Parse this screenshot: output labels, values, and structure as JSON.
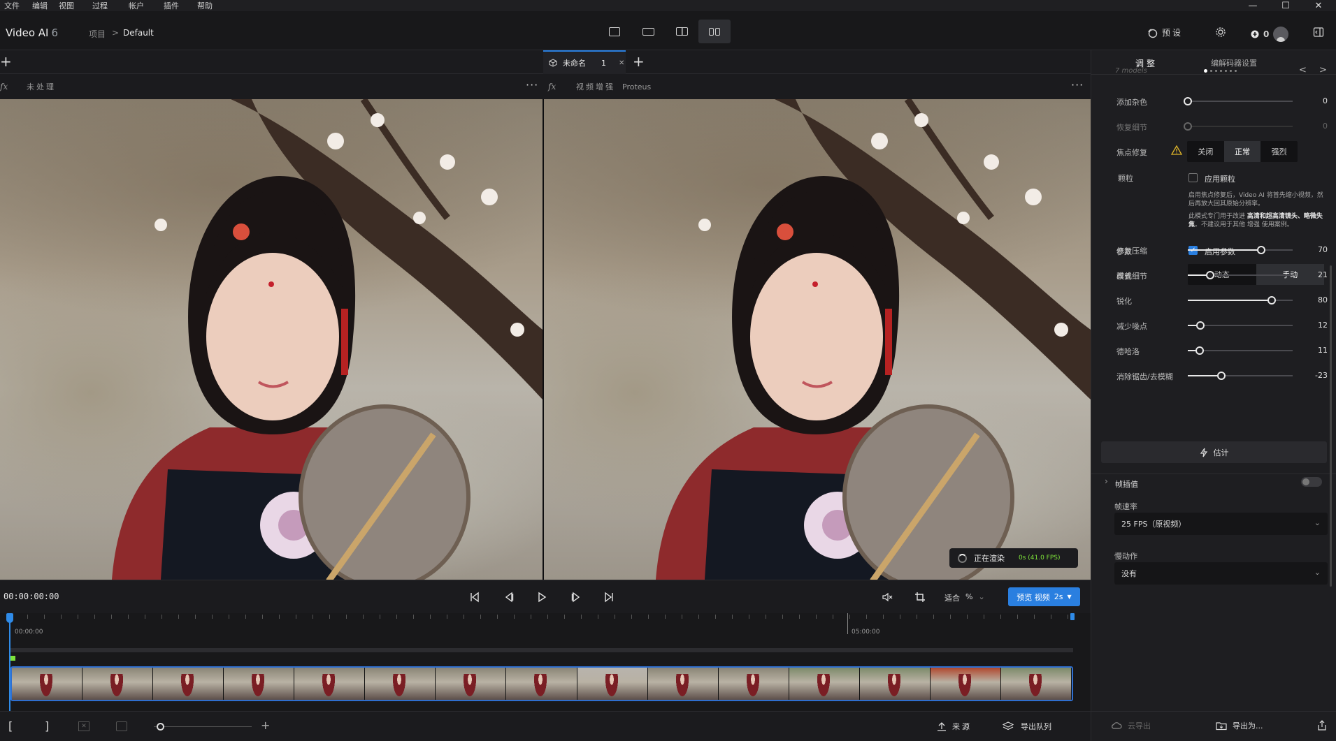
{
  "menubar": {
    "items": [
      "文件",
      "编辑",
      "视图",
      "过程",
      "帐户",
      "插件",
      "帮助"
    ]
  },
  "window_controls": {
    "minimize": "—",
    "maximize": "☐",
    "close": "✕"
  },
  "header": {
    "app_name": "Video AI",
    "app_version": "6",
    "breadcrumb_project": "项目",
    "breadcrumb_sep": ">",
    "breadcrumb_current": "Default",
    "presets_label": "预设",
    "credits": "0"
  },
  "left_pane": {
    "add_tab": "+",
    "fx_label": "fx",
    "status": "未处理",
    "more": "···"
  },
  "right_pane": {
    "tab_title": "未命名",
    "tab_count": "1",
    "tab_close": "✕",
    "add_tab": "+",
    "fx_label": "fx",
    "enhance_label": "视频增强",
    "model_name": "Proteus",
    "more": "···",
    "render_status": "正在渲染",
    "render_fps": "0s (41.0 FPS)"
  },
  "transport": {
    "timecode": "00:00:00:00",
    "zoom_label": "适合",
    "zoom_unit": "%",
    "preview_label": "预览 视频",
    "preview_duration": "2s"
  },
  "timeline": {
    "start_label": "00:00:00",
    "mid_label": "05:00:00",
    "thumb_count": 15
  },
  "bottom_bar": {
    "mark_in": "[",
    "mark_out": "]",
    "zoom_plus": "+",
    "source_label": "来源",
    "export_queue_label": "导出队列",
    "cloud_export_label": "云导出",
    "export_as_label": "导出为..."
  },
  "panel": {
    "tab_adjust": "调整",
    "tab_codec": "编解码器设置",
    "models_label": "7 models",
    "nav_prev": "<",
    "nav_next": ">",
    "add_noise": {
      "label": "添加杂色",
      "value": "0"
    },
    "recover_detail": {
      "label": "恢复细节",
      "value": "0"
    },
    "focus_fix": {
      "label": "焦点修复",
      "options": [
        "关闭",
        "正常",
        "强烈"
      ],
      "selected": "正常"
    },
    "grain": {
      "label": "颗粒",
      "checkbox": "应用颗粒"
    },
    "note1_a": "启用焦点修复后，Video AI 将首先缩小视频，然后再放大回其原始分辨率。",
    "note2_a": "此模式专门用于改进",
    "note2_b": "高清和超高清镜头、略微失焦",
    "note2_c": "。不建议用于其他 增强 使用案例。",
    "params": {
      "label": "参数",
      "checkbox": "启用参数"
    },
    "mode": {
      "label": "模式",
      "options": [
        "动态",
        "手动"
      ],
      "selected": "手动"
    },
    "sliders": [
      {
        "label": "修复压缩",
        "value": "70",
        "fraction": 0.7
      },
      {
        "label": "改善细节",
        "value": "21",
        "fraction": 0.21
      },
      {
        "label": "锐化",
        "value": "80",
        "fraction": 0.8
      },
      {
        "label": "减少噪点",
        "value": "12",
        "fraction": 0.12
      },
      {
        "label": "德哈洛",
        "value": "11",
        "fraction": 0.11
      },
      {
        "label": "消除锯齿/去模糊",
        "value": "-23",
        "fraction": 0.32
      }
    ],
    "estimate_label": "估计",
    "frame_interp_label": "帧插值",
    "frame_rate_label": "帧速率",
    "frame_rate_value": "25 FPS（原视频）",
    "slowmo_label": "慢动作",
    "slowmo_value": "没有"
  },
  "colors": {
    "accent": "#2a7fe0",
    "playhead": "#2f8be8",
    "marker": "#7ee33a"
  }
}
